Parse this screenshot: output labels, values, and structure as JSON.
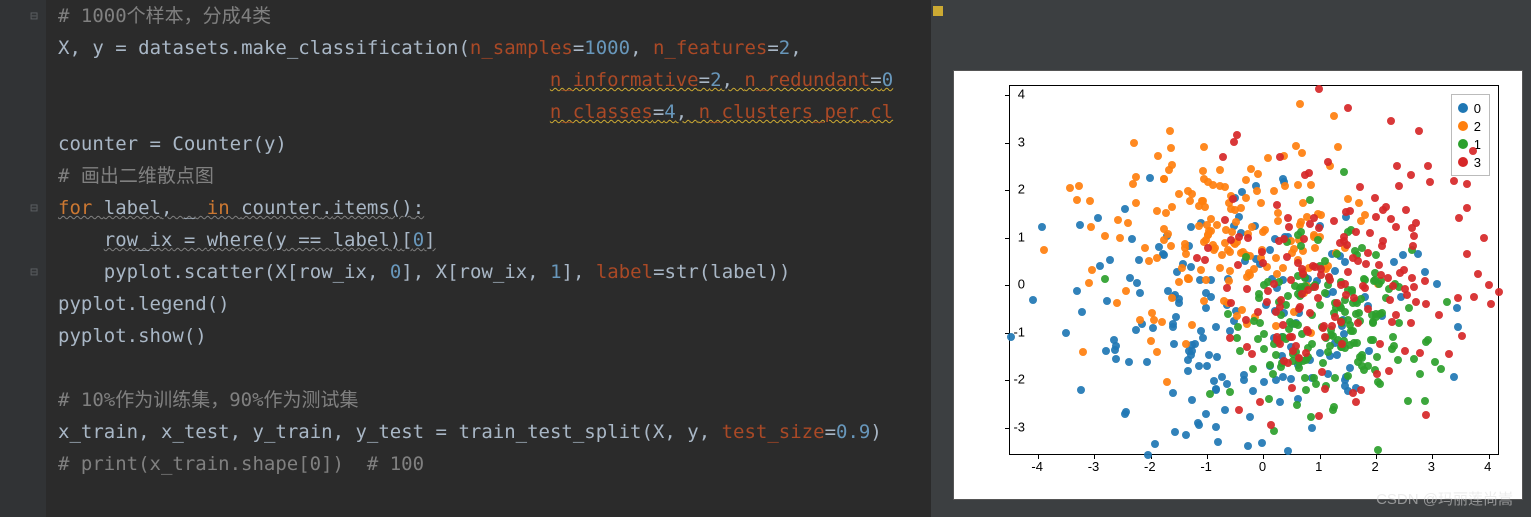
{
  "code": {
    "lines": [
      {
        "indent": 0,
        "segs": [
          [
            "comment",
            "# 1000个样本，分成4类"
          ]
        ]
      },
      {
        "indent": 0,
        "segs": [
          [
            "var",
            "X"
          ],
          [
            "def",
            ", "
          ],
          [
            "var",
            "y"
          ],
          [
            "def",
            " = "
          ],
          [
            "func",
            "datasets"
          ],
          [
            "def",
            "."
          ],
          [
            "func",
            "make_classification"
          ],
          [
            "paren",
            "("
          ],
          [
            "kwarg",
            "n_samples"
          ],
          [
            "def",
            "="
          ],
          [
            "num",
            "1000"
          ],
          [
            "def",
            ", "
          ],
          [
            "kwarg",
            "n_features"
          ],
          [
            "def",
            "="
          ],
          [
            "num",
            "2"
          ],
          [
            "def",
            ","
          ]
        ]
      },
      {
        "indent": 43,
        "segs": [
          [
            "kwarg",
            "n_informative"
          ],
          [
            "def",
            "="
          ],
          [
            "num",
            "2"
          ],
          [
            "def",
            ", "
          ],
          [
            "kwarg",
            "n_redundant"
          ],
          [
            "def",
            "="
          ],
          [
            "num",
            "0"
          ]
        ],
        "underline": "underl2"
      },
      {
        "indent": 43,
        "segs": [
          [
            "kwarg",
            "n_classes"
          ],
          [
            "def",
            "="
          ],
          [
            "num",
            "4"
          ],
          [
            "def",
            ", "
          ],
          [
            "kwarg",
            "n_clusters_per_cl"
          ]
        ],
        "underline": "underl2"
      },
      {
        "indent": 0,
        "segs": [
          [
            "var",
            "counter"
          ],
          [
            "def",
            " = "
          ],
          [
            "func",
            "Counter"
          ],
          [
            "paren",
            "("
          ],
          [
            "var",
            "y"
          ],
          [
            "paren",
            ")"
          ]
        ]
      },
      {
        "indent": 0,
        "segs": [
          [
            "comment",
            "# 画出二维散点图"
          ]
        ]
      },
      {
        "indent": 0,
        "segs": [
          [
            "keyword",
            "for "
          ],
          [
            "var",
            "label"
          ],
          [
            "def",
            ", "
          ],
          [
            "var",
            "_"
          ],
          [
            "keyword",
            " in "
          ],
          [
            "func",
            "counter"
          ],
          [
            "def",
            "."
          ],
          [
            "func",
            "items"
          ],
          [
            "paren",
            "()"
          ],
          [
            "def",
            ":"
          ]
        ],
        "underline": "underl"
      },
      {
        "indent": 4,
        "segs": [
          [
            "var",
            "row_ix"
          ],
          [
            "def",
            " = "
          ],
          [
            "func",
            "where"
          ],
          [
            "paren",
            "("
          ],
          [
            "var",
            "y"
          ],
          [
            "def",
            " == "
          ],
          [
            "var",
            "label"
          ],
          [
            "paren",
            ")"
          ],
          [
            "bracket",
            "["
          ],
          [
            "num",
            "0"
          ],
          [
            "bracket",
            "]"
          ]
        ],
        "underline": "underl"
      },
      {
        "indent": 4,
        "segs": [
          [
            "func",
            "pyplot"
          ],
          [
            "def",
            "."
          ],
          [
            "func",
            "scatter"
          ],
          [
            "paren",
            "("
          ],
          [
            "var",
            "X"
          ],
          [
            "bracket",
            "["
          ],
          [
            "var",
            "row_ix"
          ],
          [
            "def",
            ", "
          ],
          [
            "num",
            "0"
          ],
          [
            "bracket",
            "]"
          ],
          [
            "def",
            ", "
          ],
          [
            "var",
            "X"
          ],
          [
            "bracket",
            "["
          ],
          [
            "var",
            "row_ix"
          ],
          [
            "def",
            ", "
          ],
          [
            "num",
            "1"
          ],
          [
            "bracket",
            "]"
          ],
          [
            "def",
            ", "
          ],
          [
            "kwarg",
            "label"
          ],
          [
            "def",
            "="
          ],
          [
            "func",
            "str"
          ],
          [
            "paren",
            "("
          ],
          [
            "var",
            "label"
          ],
          [
            "paren",
            "))"
          ]
        ]
      },
      {
        "indent": 0,
        "segs": [
          [
            "func",
            "pyplot"
          ],
          [
            "def",
            "."
          ],
          [
            "func",
            "legend"
          ],
          [
            "paren",
            "()"
          ]
        ]
      },
      {
        "indent": 0,
        "segs": [
          [
            "func",
            "pyplot"
          ],
          [
            "def",
            "."
          ],
          [
            "func",
            "show"
          ],
          [
            "paren",
            "()"
          ]
        ]
      },
      {
        "indent": 0,
        "segs": []
      },
      {
        "indent": 0,
        "segs": [
          [
            "comment",
            "# 10%作为训练集，90%作为测试集"
          ]
        ]
      },
      {
        "indent": 0,
        "segs": [
          [
            "var",
            "x_train"
          ],
          [
            "def",
            ", "
          ],
          [
            "var",
            "x_test"
          ],
          [
            "def",
            ", "
          ],
          [
            "var",
            "y_train"
          ],
          [
            "def",
            ", "
          ],
          [
            "var",
            "y_test"
          ],
          [
            "def",
            " = "
          ],
          [
            "func",
            "train_test_split"
          ],
          [
            "paren",
            "("
          ],
          [
            "var",
            "X"
          ],
          [
            "def",
            ", "
          ],
          [
            "var",
            "y"
          ],
          [
            "def",
            ", "
          ],
          [
            "kwarg",
            "test_size"
          ],
          [
            "def",
            "="
          ],
          [
            "num",
            "0.9"
          ],
          [
            "paren",
            ")"
          ]
        ]
      },
      {
        "indent": 0,
        "segs": [
          [
            "comment",
            "# print(x_train.shape[0])  # 100"
          ]
        ]
      }
    ],
    "fold_icons": [
      0,
      6,
      8
    ]
  },
  "watermark": "CSDN @玛丽莲尚嵩",
  "chart_data": {
    "type": "scatter",
    "xlim": [
      -4.5,
      4.2
    ],
    "ylim": [
      -3.6,
      4.2
    ],
    "xticks": [
      -4,
      -3,
      -2,
      -1,
      0,
      1,
      2,
      3,
      4
    ],
    "yticks": [
      -3,
      -2,
      -1,
      0,
      1,
      2,
      3,
      4
    ],
    "legend": [
      "0",
      "2",
      "1",
      "3"
    ],
    "colors": {
      "0": "#1f77b4",
      "2": "#ff7f0e",
      "1": "#2ca02c",
      "3": "#d62728"
    },
    "series": [
      {
        "name": "0",
        "cls": "c0",
        "n": 180,
        "cx": -0.7,
        "cy": -0.8,
        "sx": 1.6,
        "sy": 1.4
      },
      {
        "name": "2",
        "cls": "c1",
        "n": 180,
        "cx": -0.6,
        "cy": 1.1,
        "sx": 1.2,
        "sy": 1.0
      },
      {
        "name": "1",
        "cls": "c2",
        "n": 180,
        "cx": 1.2,
        "cy": -0.9,
        "sx": 0.9,
        "sy": 0.9
      },
      {
        "name": "3",
        "cls": "c3",
        "n": 180,
        "cx": 1.5,
        "cy": 0.5,
        "sx": 1.3,
        "sy": 1.4
      }
    ]
  }
}
